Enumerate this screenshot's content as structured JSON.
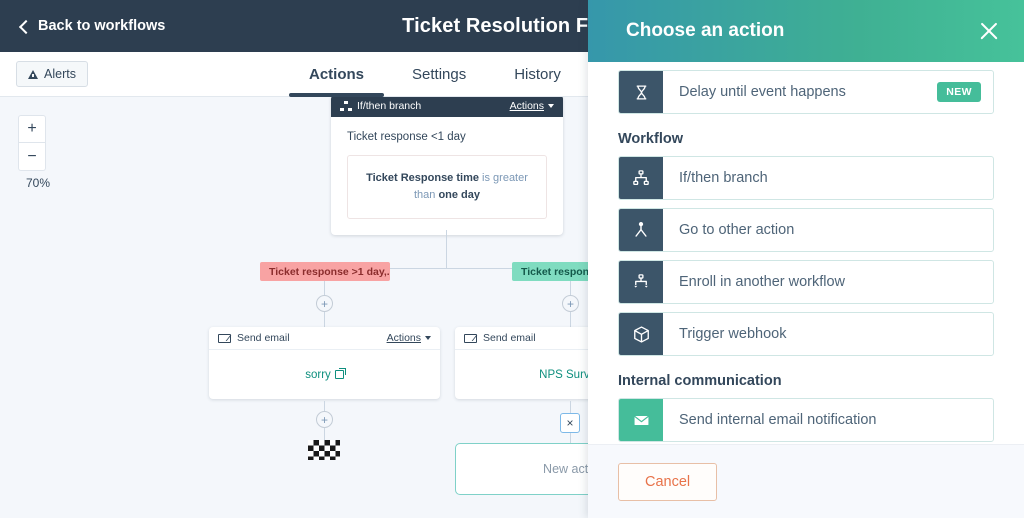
{
  "topnav": {
    "back_label": "Back to workflows",
    "workflow_title": "Ticket Resolution Flow"
  },
  "tabbar": {
    "alerts_label": "Alerts",
    "tabs": [
      {
        "label": "Actions",
        "active": true
      },
      {
        "label": "Settings",
        "active": false
      },
      {
        "label": "History",
        "active": false
      }
    ]
  },
  "canvas": {
    "zoom": {
      "in_label": "+",
      "out_label": "−",
      "level_label": "70%"
    },
    "if_then_card": {
      "header_title": "If/then branch",
      "header_actions": "Actions",
      "branch_name": "Ticket response <1 day",
      "condition_property": "Ticket Response time",
      "condition_operator": " is greater than ",
      "condition_value": "one day"
    },
    "branches": [
      {
        "label": "Ticket response >1 day,...",
        "style": "red"
      },
      {
        "label": "Ticket response",
        "style": "green"
      }
    ],
    "plus_label": "+",
    "email_cards": [
      {
        "header_title": "Send email",
        "header_actions": "Actions",
        "body_label": "sorry"
      },
      {
        "header_title": "Send email",
        "header_actions": "",
        "body_label": "NPS Survey"
      }
    ],
    "new_action_placeholder": "New actio",
    "close_label": "×"
  },
  "panel": {
    "title": "Choose an action",
    "close_icon": "close-icon",
    "top_item": {
      "label": "Delay until event happens",
      "badge": "NEW",
      "icon": "hourglass-icon"
    },
    "groups": [
      {
        "title": "Workflow",
        "items": [
          {
            "label": "If/then branch",
            "icon": "branch-icon",
            "tone": "dark"
          },
          {
            "label": "Go to other action",
            "icon": "goto-action-icon",
            "tone": "dark"
          },
          {
            "label": "Enroll in another workflow",
            "icon": "enroll-workflow-icon",
            "tone": "dark"
          },
          {
            "label": "Trigger webhook",
            "icon": "cube-icon",
            "tone": "dark"
          }
        ]
      },
      {
        "title": "Internal communication",
        "items": [
          {
            "label": "Send internal email notification",
            "icon": "envelope-icon",
            "tone": "green"
          }
        ]
      }
    ],
    "cancel_label": "Cancel"
  },
  "colors": {
    "nav_dark": "#2d3e50",
    "panel_gradient_start": "#3697ab",
    "panel_gradient_end": "#46c29a",
    "accent_green": "#45bd9a",
    "icon_dark": "#3c5569",
    "branch_red": "#f8a3a3",
    "branch_green": "#7fdcc0",
    "cancel_orange": "#e8734a"
  }
}
